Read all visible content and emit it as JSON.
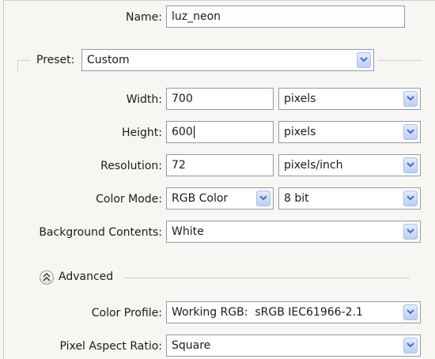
{
  "name": {
    "label": "Name:",
    "value": "luz_neon"
  },
  "preset": {
    "label": "Preset:",
    "value": "Custom"
  },
  "width": {
    "label": "Width:",
    "value": "700",
    "unit": "pixels"
  },
  "height": {
    "label": "Height:",
    "value": "600",
    "unit": "pixels"
  },
  "resolution": {
    "label": "Resolution:",
    "value": "72",
    "unit": "pixels/inch"
  },
  "color_mode": {
    "label": "Color Mode:",
    "mode": "RGB Color",
    "depth": "8 bit"
  },
  "background": {
    "label": "Background Contents:",
    "value": "White"
  },
  "advanced": {
    "label": "Advanced",
    "icon": "chevron-up-double-icon"
  },
  "color_profile": {
    "label": "Color Profile:",
    "value": "Working RGB:  sRGB IEC61966-2.1"
  },
  "pixel_aspect": {
    "label": "Pixel Aspect Ratio:",
    "value": "Square"
  },
  "colors": {
    "dropdown_arrow": "#4a6fcf",
    "field_border": "#8f9aa8",
    "background": "#f7f6f2"
  }
}
